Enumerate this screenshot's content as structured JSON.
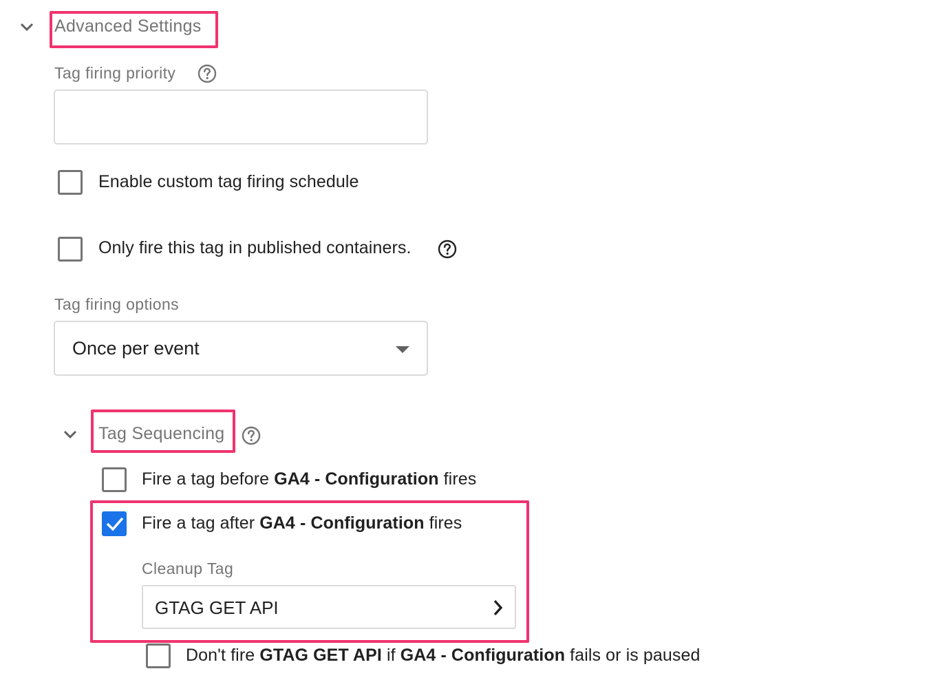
{
  "advanced_settings": {
    "title": "Advanced Settings",
    "tag_firing_priority": {
      "label": "Tag firing priority",
      "value": ""
    },
    "custom_schedule": {
      "label": "Enable custom tag firing schedule",
      "checked": false
    },
    "published_only": {
      "label": "Only fire this tag in published containers.",
      "checked": false
    },
    "tag_firing_options": {
      "label": "Tag firing options",
      "selected": "Once per event"
    }
  },
  "tag_sequencing": {
    "title": "Tag Sequencing",
    "fire_before": {
      "prefix": "Fire a tag before ",
      "tag_name": "GA4 - Configuration",
      "suffix": " fires",
      "checked": false
    },
    "fire_after": {
      "prefix": "Fire a tag after ",
      "tag_name": "GA4 - Configuration",
      "suffix": " fires",
      "checked": true
    },
    "cleanup_tag": {
      "label": "Cleanup Tag",
      "value": "GTAG GET API"
    },
    "dont_fire": {
      "part1": "Don't fire ",
      "bold1": "GTAG GET API",
      "part2": " if ",
      "bold2": "GA4 - Configuration",
      "part3": " fails or is paused",
      "checked": false
    }
  },
  "colors": {
    "highlight": "#f0336e",
    "checkbox_checked": "#1a73e8",
    "label_gray": "#757575"
  },
  "icons": [
    "chevron-down-icon",
    "help-icon",
    "dropdown-arrow-icon",
    "chevron-right-icon",
    "checkmark-icon"
  ]
}
